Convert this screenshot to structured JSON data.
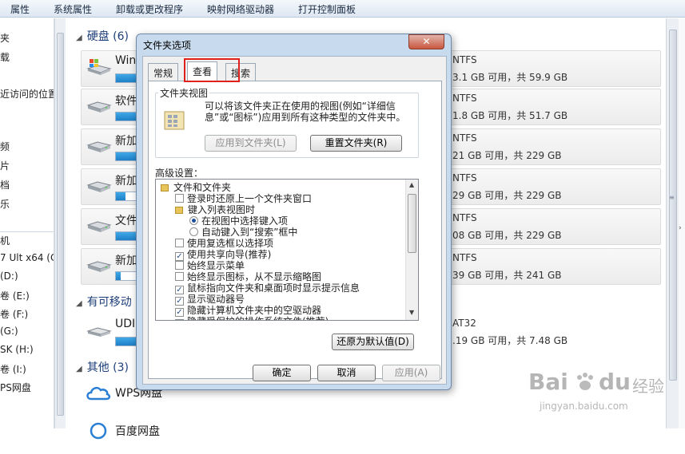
{
  "toolbar": {
    "items": [
      "属性",
      "系统属性",
      "卸载或更改程序",
      "映射网络驱动器",
      "打开控制面板"
    ]
  },
  "nav": {
    "items": [
      "夹",
      "载",
      "近访问的位置",
      "",
      "",
      "频",
      "片",
      "档",
      "乐",
      "",
      "",
      "机",
      "7 Ult x64 (C",
      "(D:)",
      "卷 (E:)",
      "卷 (F:)",
      "(G:)",
      "SK (H:)",
      "卷 (I:)",
      "PS网盘"
    ]
  },
  "main": {
    "groups": [
      {
        "title": "硬盘 (6)"
      },
      {
        "title": "有可移动"
      },
      {
        "title": "其他 (3)"
      }
    ],
    "drives": [
      {
        "name": "Win",
        "fs": "NTFS",
        "space": "3.1 GB 可用，共 59.9 GB",
        "used_fraction": 0.95
      },
      {
        "name": "软件",
        "fs": "NTFS",
        "space": "1.8 GB 可用，共 51.7 GB",
        "used_fraction": 0.96
      },
      {
        "name": "新加",
        "fs": "NTFS",
        "space": "21 GB 可用，共 229 GB",
        "used_fraction": 0.91
      },
      {
        "name": "新加",
        "fs": "NTFS",
        "space": "29 GB 可用，共 229 GB",
        "used_fraction": 0.2
      },
      {
        "name": "文件",
        "fs": "NTFS",
        "space": "08 GB 可用，共 229 GB",
        "used_fraction": 0.96
      },
      {
        "name": "新加",
        "fs": "NTFS",
        "space": "39 GB 可用，共 241 GB",
        "used_fraction": 0.1
      }
    ],
    "removable": {
      "name": "UDI",
      "fs": "AT32",
      "space": ".19 GB 可用，共 7.48 GB",
      "used_fraction": 0.95
    },
    "others": [
      {
        "name": "WPS网盘"
      },
      {
        "name": "百度网盘"
      }
    ]
  },
  "dialog": {
    "title": "文件夹选项",
    "close": "✕",
    "tabs": [
      "常规",
      "查看",
      "搜索"
    ],
    "active_tab": "查看",
    "folder_view": {
      "legend": "文件夹视图",
      "description": "可以将该文件夹正在使用的视图(例如“详细信息”或“图标”)应用到所有这种类型的文件夹中。",
      "apply_button": "应用到文件夹(L)",
      "reset_button": "重置文件夹(R)"
    },
    "advanced": {
      "label": "高级设置：",
      "items": [
        {
          "type": "folder",
          "label": "文件和文件夹",
          "indent": 0
        },
        {
          "type": "check",
          "label": "登录时还原上一个文件夹窗口",
          "checked": false,
          "indent": 1
        },
        {
          "type": "folder",
          "label": "键入列表视图时",
          "indent": 1
        },
        {
          "type": "radio",
          "label": "在视图中选择键入项",
          "checked": true,
          "indent": 2
        },
        {
          "type": "radio",
          "label": "自动键入到“搜索”框中",
          "checked": false,
          "indent": 2
        },
        {
          "type": "check",
          "label": "使用复选框以选择项",
          "checked": false,
          "indent": 1
        },
        {
          "type": "check",
          "label": "使用共享向导(推荐)",
          "checked": true,
          "indent": 1
        },
        {
          "type": "check",
          "label": "始终显示菜单",
          "checked": false,
          "indent": 1
        },
        {
          "type": "check",
          "label": "始终显示图标，从不显示缩略图",
          "checked": false,
          "indent": 1
        },
        {
          "type": "check",
          "label": "鼠标指向文件夹和桌面项时显示提示信息",
          "checked": true,
          "indent": 1
        },
        {
          "type": "check",
          "label": "显示驱动器号",
          "checked": true,
          "indent": 1
        },
        {
          "type": "check",
          "label": "隐藏计算机文件夹中的空驱动器",
          "checked": true,
          "indent": 1
        },
        {
          "type": "check",
          "label": "隐藏受保护的操作系统文件(推荐)",
          "checked": true,
          "indent": 1
        }
      ],
      "restore_button": "还原为默认值(D)"
    },
    "ok_button": "确定",
    "cancel_button": "取消",
    "apply_button": "应用(A)"
  },
  "watermark": {
    "brand": "Bai",
    "brand2": "du",
    "suffix": "经验",
    "url": "jingyan.baidu.com"
  },
  "colors": {
    "highlight_box": "#e0201a",
    "accent_blue": "#1e7fc6"
  }
}
